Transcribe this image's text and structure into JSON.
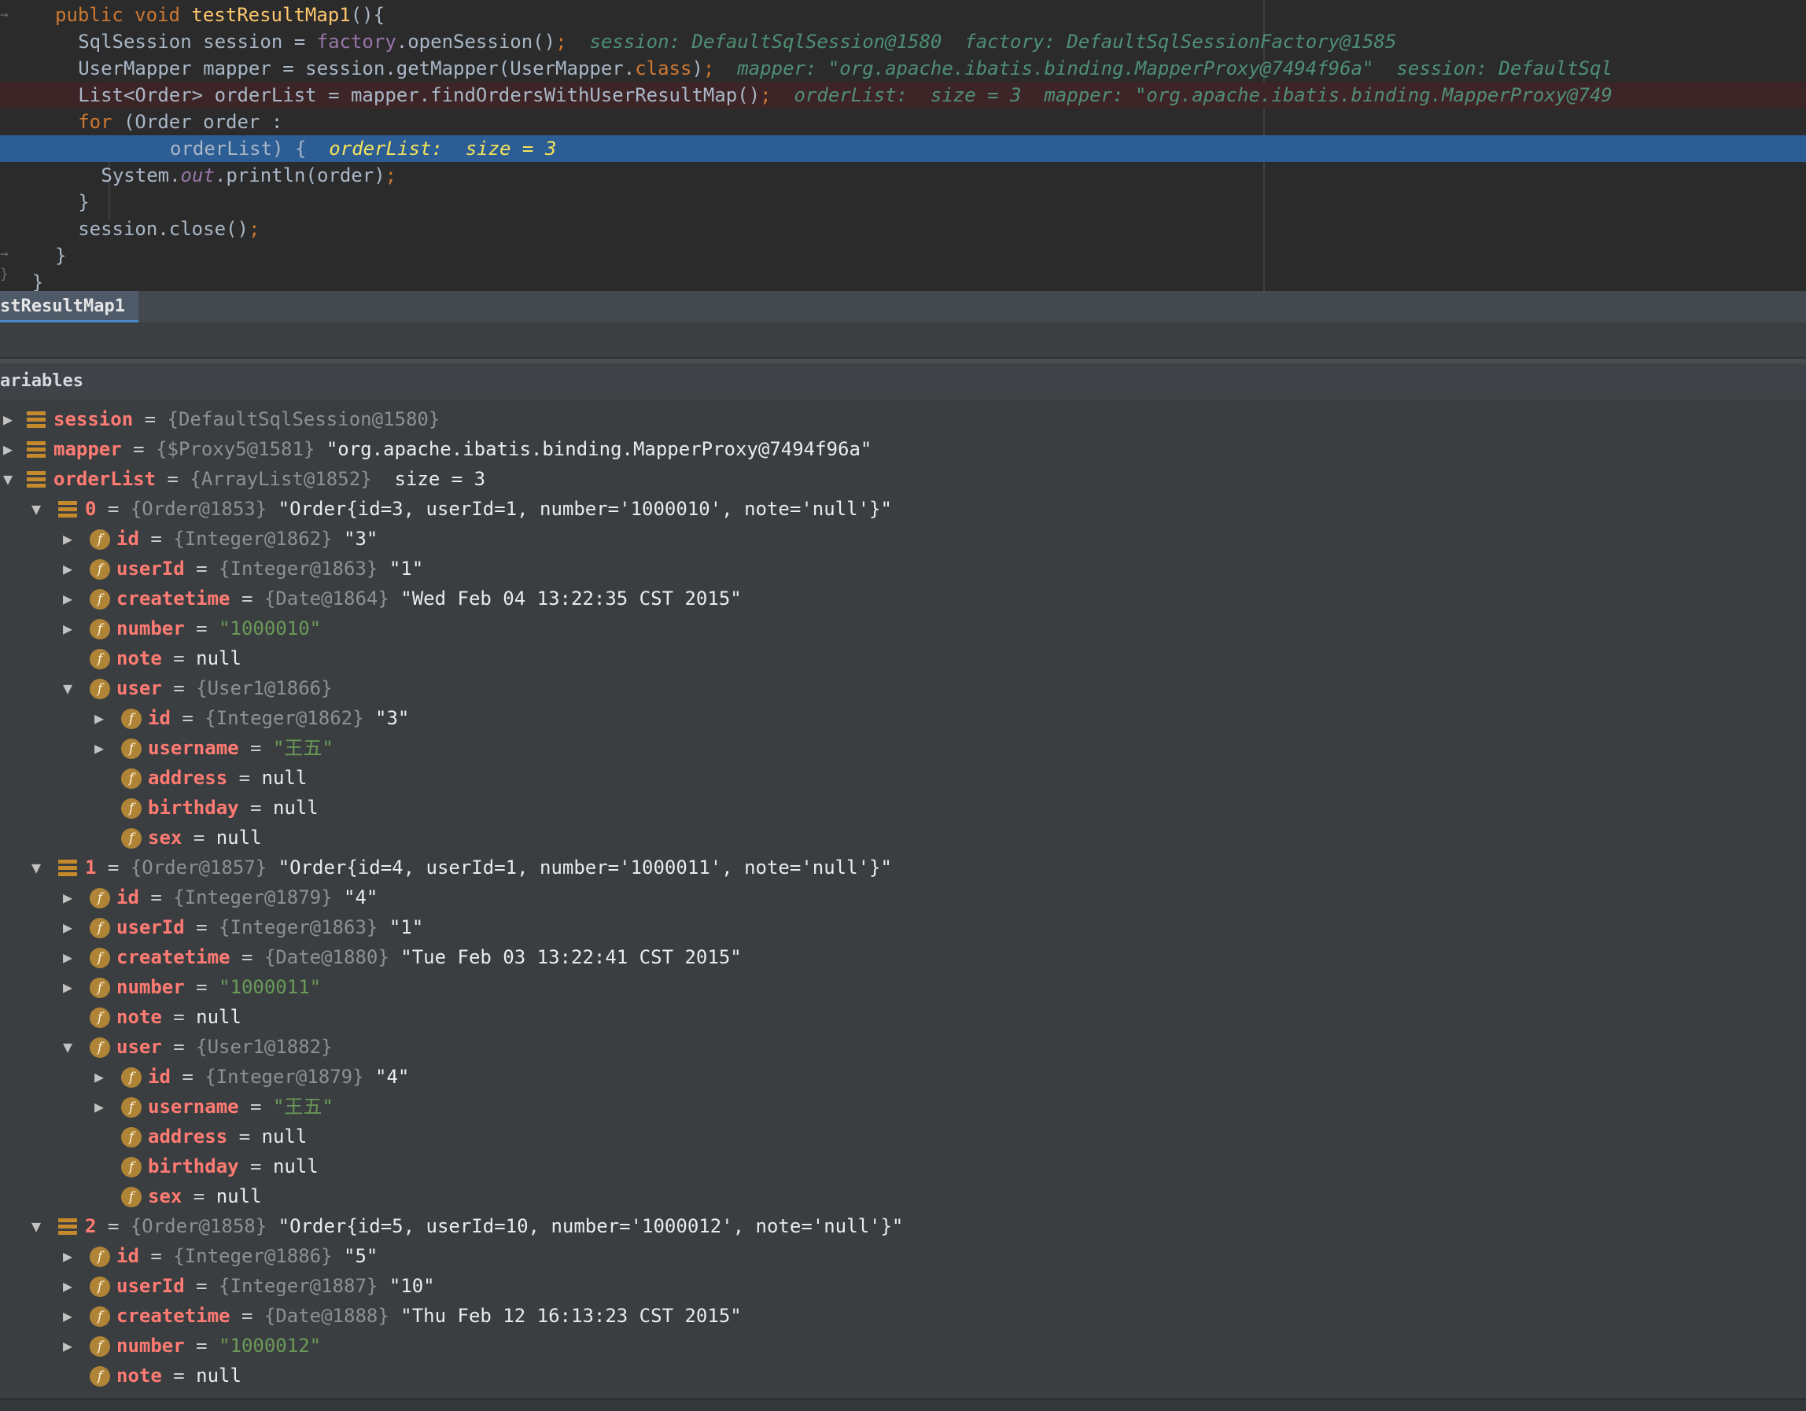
{
  "editor": {
    "gutter_marks": [
      "→",
      "→",
      "}"
    ],
    "lines": [
      {
        "indent": "  ",
        "parts": [
          [
            "kw",
            "public "
          ],
          [
            "kw",
            "void "
          ],
          [
            "fn",
            "testResultMap1"
          ],
          [
            "",
            "(){"
          ]
        ]
      },
      {
        "indent": "    ",
        "parts": [
          [
            "",
            "SqlSession session = "
          ],
          [
            "fld",
            "factory"
          ],
          [
            "",
            ".openSession()"
          ],
          [
            "kw",
            ";"
          ],
          [
            "",
            "  "
          ],
          [
            "dbg",
            "session: DefaultSqlSession@1580  factory: DefaultSqlSessionFactory@1585"
          ]
        ]
      },
      {
        "indent": "    ",
        "parts": [
          [
            "",
            "UserMapper mapper = session.getMapper(UserMapper."
          ],
          [
            "kw",
            "class"
          ],
          [
            "",
            ")"
          ],
          [
            "kw",
            ";"
          ],
          [
            "",
            "  "
          ],
          [
            "dbg",
            "mapper: \"org.apache.ibatis.binding.MapperProxy@7494f96a\"  session: DefaultSql"
          ]
        ]
      },
      {
        "indent": "    ",
        "parts": [
          [
            "",
            "List<Order> orderList = mapper.findOrdersWithUserResultMap()"
          ],
          [
            "kw",
            ";"
          ],
          [
            "",
            "  "
          ],
          [
            "dbg",
            "orderList:  size = 3  mapper: \"org.apache.ibatis.binding.MapperProxy@749"
          ]
        ]
      },
      {
        "indent": "    ",
        "parts": [
          [
            "kw",
            "for "
          ],
          [
            "",
            "(Order order :"
          ]
        ]
      },
      {
        "indent": "            ",
        "parts": [
          [
            "",
            "orderList) {  "
          ],
          [
            "dbg-cur",
            "orderList:  size = 3"
          ]
        ]
      },
      {
        "indent": "      ",
        "parts": [
          [
            "",
            "System."
          ],
          [
            "fld it",
            "out"
          ],
          [
            "",
            ".println(order)"
          ],
          [
            "kw",
            ";"
          ]
        ]
      },
      {
        "indent": "    ",
        "parts": [
          [
            "",
            "}"
          ]
        ]
      },
      {
        "indent": "    ",
        "parts": [
          [
            "",
            "session.close()"
          ],
          [
            "kw",
            ";"
          ]
        ]
      },
      {
        "indent": "  ",
        "parts": [
          [
            "",
            "}"
          ]
        ]
      },
      {
        "indent": "",
        "parts": [
          [
            "",
            "}"
          ]
        ]
      }
    ]
  },
  "tab": {
    "label": "stResultMap1"
  },
  "variables_header": "ariables",
  "tree": [
    {
      "level": 0,
      "arrow": "right",
      "icon": "array",
      "name": "session",
      "type": "{DefaultSqlSession@1580}",
      "value": "",
      "str": false
    },
    {
      "level": 0,
      "arrow": "right",
      "icon": "array",
      "name": "mapper",
      "type": "{$Proxy5@1581}",
      "value": "\"org.apache.ibatis.binding.MapperProxy@7494f96a\"",
      "str": false
    },
    {
      "level": 0,
      "arrow": "down",
      "icon": "array",
      "name": "orderList",
      "type": "{ArrayList@1852}",
      "value": " size = 3",
      "str": false
    },
    {
      "level": 1,
      "arrow": "down",
      "icon": "array",
      "name": "0",
      "type": "{Order@1853}",
      "value": "\"Order{id=3, userId=1, number='1000010', note='null'}\"",
      "str": false
    },
    {
      "level": 2,
      "arrow": "right",
      "icon": "field",
      "name": "id",
      "type": "{Integer@1862}",
      "value": "\"3\"",
      "str": false
    },
    {
      "level": 2,
      "arrow": "right",
      "icon": "field",
      "name": "userId",
      "type": "{Integer@1863}",
      "value": "\"1\"",
      "str": false
    },
    {
      "level": 2,
      "arrow": "right",
      "icon": "field",
      "name": "createtime",
      "type": "{Date@1864}",
      "value": "\"Wed Feb 04 13:22:35 CST 2015\"",
      "str": false
    },
    {
      "level": 2,
      "arrow": "right",
      "icon": "field",
      "name": "number",
      "type": "",
      "value": "\"1000010\"",
      "str": true
    },
    {
      "level": 2,
      "arrow": "none",
      "icon": "field",
      "name": "note",
      "type": "",
      "value": "null",
      "str": false
    },
    {
      "level": 2,
      "arrow": "down",
      "icon": "field",
      "name": "user",
      "type": "{User1@1866}",
      "value": "",
      "str": false
    },
    {
      "level": 3,
      "arrow": "right",
      "icon": "field",
      "name": "id",
      "type": "{Integer@1862}",
      "value": "\"3\"",
      "str": false
    },
    {
      "level": 3,
      "arrow": "right",
      "icon": "field",
      "name": "username",
      "type": "",
      "value": "\"王五\"",
      "str": true
    },
    {
      "level": 3,
      "arrow": "none",
      "icon": "field",
      "name": "address",
      "type": "",
      "value": "null",
      "str": false
    },
    {
      "level": 3,
      "arrow": "none",
      "icon": "field",
      "name": "birthday",
      "type": "",
      "value": "null",
      "str": false
    },
    {
      "level": 3,
      "arrow": "none",
      "icon": "field",
      "name": "sex",
      "type": "",
      "value": "null",
      "str": false
    },
    {
      "level": 1,
      "arrow": "down",
      "icon": "array",
      "name": "1",
      "type": "{Order@1857}",
      "value": "\"Order{id=4, userId=1, number='1000011', note='null'}\"",
      "str": false
    },
    {
      "level": 2,
      "arrow": "right",
      "icon": "field",
      "name": "id",
      "type": "{Integer@1879}",
      "value": "\"4\"",
      "str": false
    },
    {
      "level": 2,
      "arrow": "right",
      "icon": "field",
      "name": "userId",
      "type": "{Integer@1863}",
      "value": "\"1\"",
      "str": false
    },
    {
      "level": 2,
      "arrow": "right",
      "icon": "field",
      "name": "createtime",
      "type": "{Date@1880}",
      "value": "\"Tue Feb 03 13:22:41 CST 2015\"",
      "str": false
    },
    {
      "level": 2,
      "arrow": "right",
      "icon": "field",
      "name": "number",
      "type": "",
      "value": "\"1000011\"",
      "str": true
    },
    {
      "level": 2,
      "arrow": "none",
      "icon": "field",
      "name": "note",
      "type": "",
      "value": "null",
      "str": false
    },
    {
      "level": 2,
      "arrow": "down",
      "icon": "field",
      "name": "user",
      "type": "{User1@1882}",
      "value": "",
      "str": false
    },
    {
      "level": 3,
      "arrow": "right",
      "icon": "field",
      "name": "id",
      "type": "{Integer@1879}",
      "value": "\"4\"",
      "str": false
    },
    {
      "level": 3,
      "arrow": "right",
      "icon": "field",
      "name": "username",
      "type": "",
      "value": "\"王五\"",
      "str": true
    },
    {
      "level": 3,
      "arrow": "none",
      "icon": "field",
      "name": "address",
      "type": "",
      "value": "null",
      "str": false
    },
    {
      "level": 3,
      "arrow": "none",
      "icon": "field",
      "name": "birthday",
      "type": "",
      "value": "null",
      "str": false
    },
    {
      "level": 3,
      "arrow": "none",
      "icon": "field",
      "name": "sex",
      "type": "",
      "value": "null",
      "str": false
    },
    {
      "level": 1,
      "arrow": "down",
      "icon": "array",
      "name": "2",
      "type": "{Order@1858}",
      "value": "\"Order{id=5, userId=10, number='1000012', note='null'}\"",
      "str": false
    },
    {
      "level": 2,
      "arrow": "right",
      "icon": "field",
      "name": "id",
      "type": "{Integer@1886}",
      "value": "\"5\"",
      "str": false
    },
    {
      "level": 2,
      "arrow": "right",
      "icon": "field",
      "name": "userId",
      "type": "{Integer@1887}",
      "value": "\"10\"",
      "str": false
    },
    {
      "level": 2,
      "arrow": "right",
      "icon": "field",
      "name": "createtime",
      "type": "{Date@1888}",
      "value": "\"Thu Feb 12 16:13:23 CST 2015\"",
      "str": false
    },
    {
      "level": 2,
      "arrow": "right",
      "icon": "field",
      "name": "number",
      "type": "",
      "value": "\"1000012\"",
      "str": true
    },
    {
      "level": 2,
      "arrow": "none",
      "icon": "field",
      "name": "note",
      "type": "",
      "value": "null",
      "str": false
    }
  ]
}
